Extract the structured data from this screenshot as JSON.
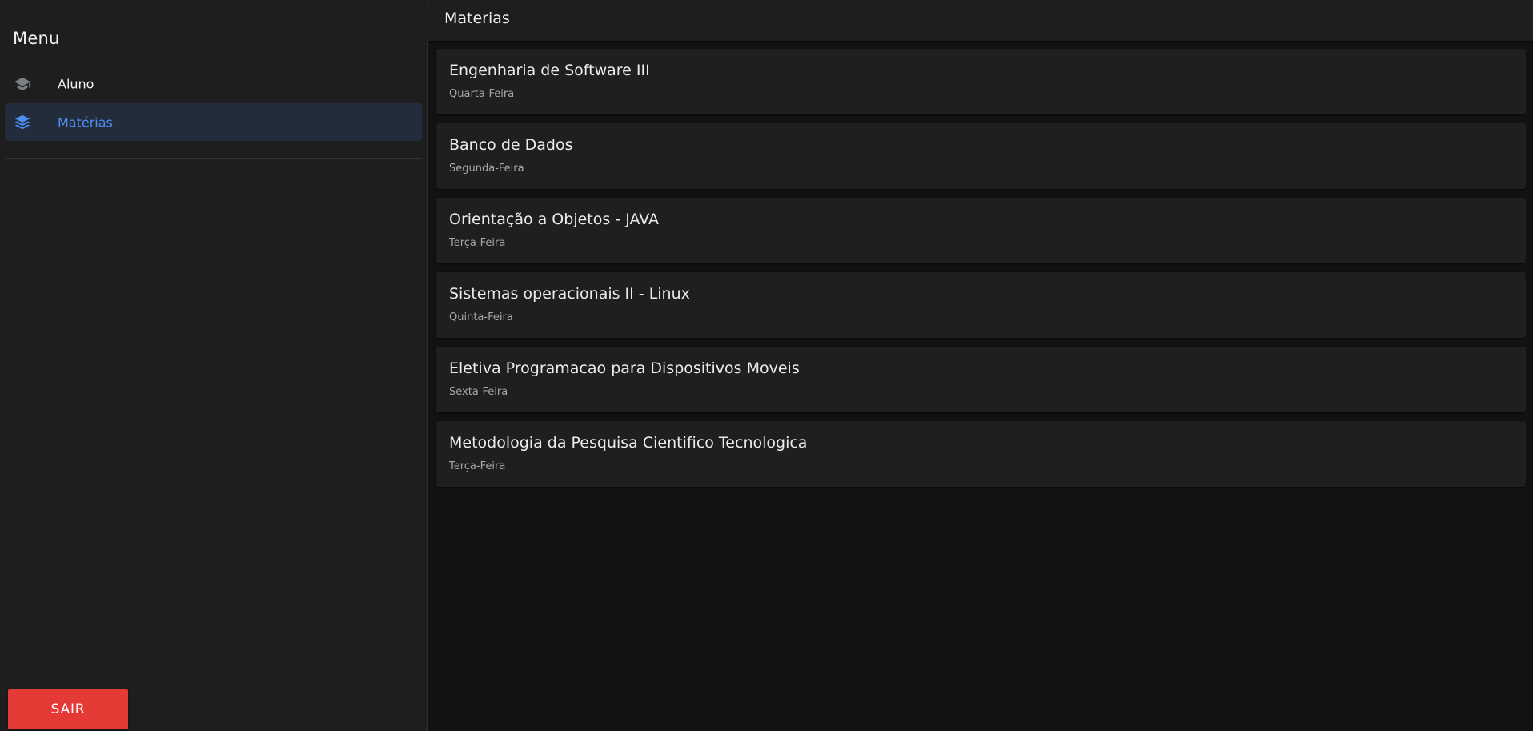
{
  "sidebar": {
    "title": "Menu",
    "items": [
      {
        "label": "Aluno",
        "icon": "graduation-cap-icon",
        "active": false
      },
      {
        "label": "Matérias",
        "icon": "layers-icon",
        "active": true
      }
    ],
    "logout_label": "SAIR"
  },
  "header": {
    "title": "Materias"
  },
  "subjects": [
    {
      "name": "Engenharia de Software III",
      "day": "Quarta-Feira"
    },
    {
      "name": "Banco de Dados",
      "day": "Segunda-Feira"
    },
    {
      "name": "Orientação a Objetos - JAVA",
      "day": "Terça-Feira"
    },
    {
      "name": "Sistemas operacionais II - Linux",
      "day": "Quinta-Feira"
    },
    {
      "name": "Eletiva Programacao para Dispositivos Moveis",
      "day": "Sexta-Feira"
    },
    {
      "name": "Metodologia da Pesquisa Cientifico Tecnologica",
      "day": "Terça-Feira"
    }
  ],
  "colors": {
    "accent": "#4d8ef7",
    "logout": "#e53935",
    "sidebar_bg": "#1e1e1e",
    "main_bg": "#121212",
    "card_bg": "#1f1f1f"
  }
}
